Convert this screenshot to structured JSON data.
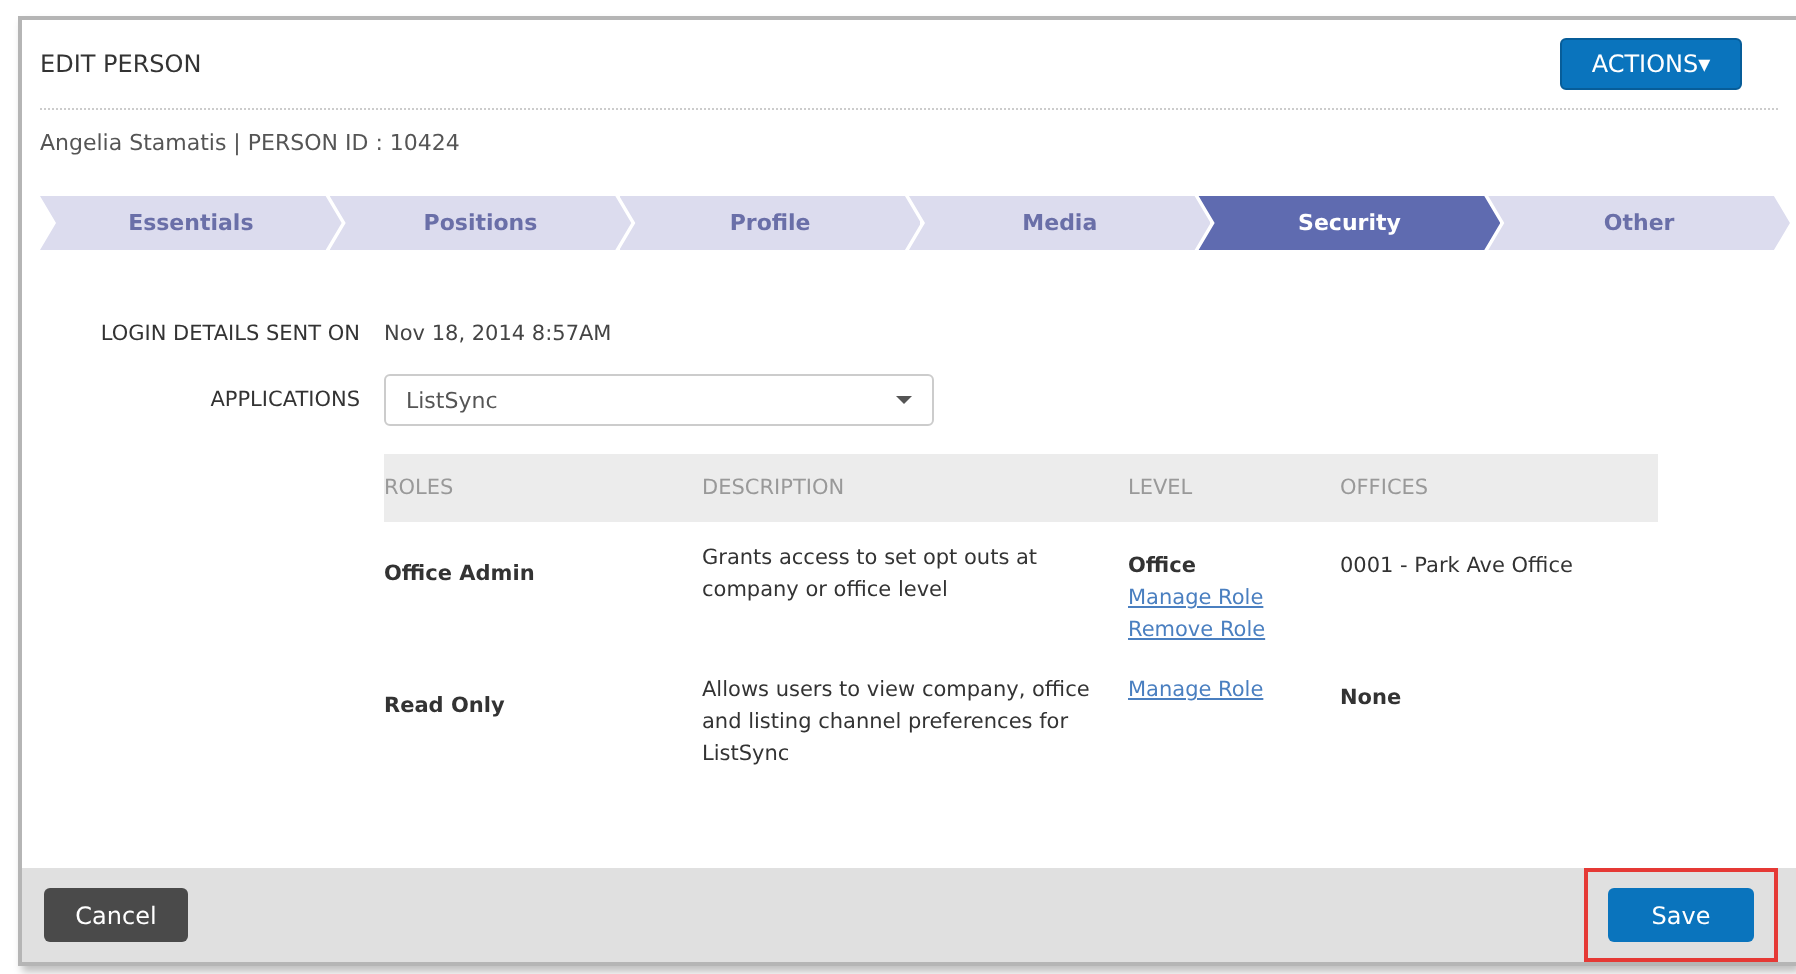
{
  "header": {
    "title": "EDIT PERSON",
    "actions_button": "ACTIONS▾"
  },
  "person_line": "Angelia Stamatis | PERSON ID : 10424",
  "tabs": [
    {
      "label": "Essentials",
      "selected": false
    },
    {
      "label": "Positions",
      "selected": false
    },
    {
      "label": "Profile",
      "selected": false
    },
    {
      "label": "Media",
      "selected": false
    },
    {
      "label": "Security",
      "selected": true
    },
    {
      "label": "Other",
      "selected": false
    }
  ],
  "login_details": {
    "label": "LOGIN DETAILS SENT ON",
    "value": "Nov 18, 2014 8:57AM"
  },
  "applications": {
    "label": "APPLICATIONS",
    "value": "ListSync"
  },
  "table": {
    "columns": [
      "ROLES",
      "DESCRIPTION",
      "LEVEL",
      "OFFICES"
    ],
    "rows": [
      {
        "role": "Office Admin",
        "description": "Grants access to set opt outs at company or office level",
        "level": "Office",
        "links": [
          "Manage Role",
          "Remove Role"
        ],
        "offices": "0001 - Park Ave Office"
      },
      {
        "role": "Read Only",
        "description": "Allows users to view company, office and listing channel preferences for ListSync",
        "level": "",
        "links": [
          "Manage Role"
        ],
        "offices": "None"
      }
    ]
  },
  "footer": {
    "cancel": "Cancel",
    "save": {
      "label": "Save",
      "highlighted": true
    }
  }
}
